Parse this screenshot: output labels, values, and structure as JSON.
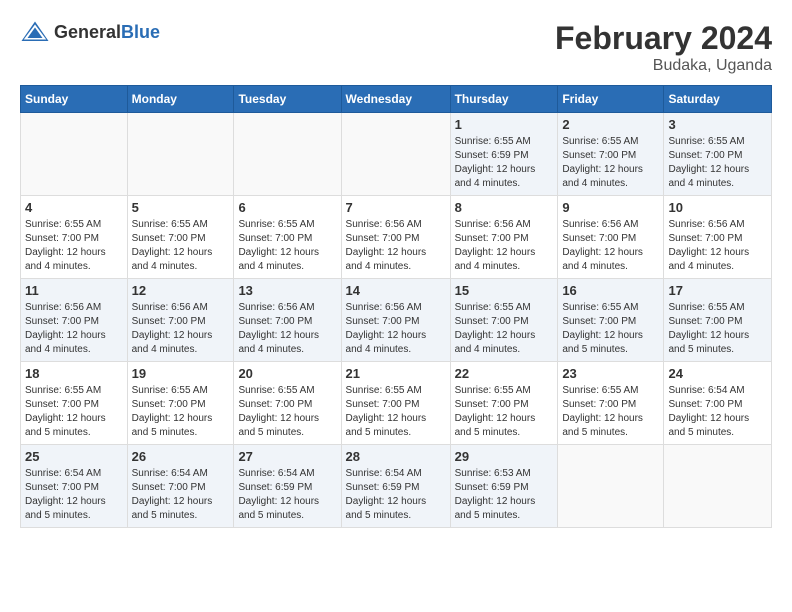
{
  "header": {
    "logo_general": "General",
    "logo_blue": "Blue",
    "title": "February 2024",
    "subtitle": "Budaka, Uganda"
  },
  "calendar": {
    "days_of_week": [
      "Sunday",
      "Monday",
      "Tuesday",
      "Wednesday",
      "Thursday",
      "Friday",
      "Saturday"
    ],
    "weeks": [
      [
        {
          "day": "",
          "info": ""
        },
        {
          "day": "",
          "info": ""
        },
        {
          "day": "",
          "info": ""
        },
        {
          "day": "",
          "info": ""
        },
        {
          "day": "1",
          "info": "Sunrise: 6:55 AM\nSunset: 6:59 PM\nDaylight: 12 hours\nand 4 minutes."
        },
        {
          "day": "2",
          "info": "Sunrise: 6:55 AM\nSunset: 7:00 PM\nDaylight: 12 hours\nand 4 minutes."
        },
        {
          "day": "3",
          "info": "Sunrise: 6:55 AM\nSunset: 7:00 PM\nDaylight: 12 hours\nand 4 minutes."
        }
      ],
      [
        {
          "day": "4",
          "info": "Sunrise: 6:55 AM\nSunset: 7:00 PM\nDaylight: 12 hours\nand 4 minutes."
        },
        {
          "day": "5",
          "info": "Sunrise: 6:55 AM\nSunset: 7:00 PM\nDaylight: 12 hours\nand 4 minutes."
        },
        {
          "day": "6",
          "info": "Sunrise: 6:55 AM\nSunset: 7:00 PM\nDaylight: 12 hours\nand 4 minutes."
        },
        {
          "day": "7",
          "info": "Sunrise: 6:56 AM\nSunset: 7:00 PM\nDaylight: 12 hours\nand 4 minutes."
        },
        {
          "day": "8",
          "info": "Sunrise: 6:56 AM\nSunset: 7:00 PM\nDaylight: 12 hours\nand 4 minutes."
        },
        {
          "day": "9",
          "info": "Sunrise: 6:56 AM\nSunset: 7:00 PM\nDaylight: 12 hours\nand 4 minutes."
        },
        {
          "day": "10",
          "info": "Sunrise: 6:56 AM\nSunset: 7:00 PM\nDaylight: 12 hours\nand 4 minutes."
        }
      ],
      [
        {
          "day": "11",
          "info": "Sunrise: 6:56 AM\nSunset: 7:00 PM\nDaylight: 12 hours\nand 4 minutes."
        },
        {
          "day": "12",
          "info": "Sunrise: 6:56 AM\nSunset: 7:00 PM\nDaylight: 12 hours\nand 4 minutes."
        },
        {
          "day": "13",
          "info": "Sunrise: 6:56 AM\nSunset: 7:00 PM\nDaylight: 12 hours\nand 4 minutes."
        },
        {
          "day": "14",
          "info": "Sunrise: 6:56 AM\nSunset: 7:00 PM\nDaylight: 12 hours\nand 4 minutes."
        },
        {
          "day": "15",
          "info": "Sunrise: 6:55 AM\nSunset: 7:00 PM\nDaylight: 12 hours\nand 4 minutes."
        },
        {
          "day": "16",
          "info": "Sunrise: 6:55 AM\nSunset: 7:00 PM\nDaylight: 12 hours\nand 5 minutes."
        },
        {
          "day": "17",
          "info": "Sunrise: 6:55 AM\nSunset: 7:00 PM\nDaylight: 12 hours\nand 5 minutes."
        }
      ],
      [
        {
          "day": "18",
          "info": "Sunrise: 6:55 AM\nSunset: 7:00 PM\nDaylight: 12 hours\nand 5 minutes."
        },
        {
          "day": "19",
          "info": "Sunrise: 6:55 AM\nSunset: 7:00 PM\nDaylight: 12 hours\nand 5 minutes."
        },
        {
          "day": "20",
          "info": "Sunrise: 6:55 AM\nSunset: 7:00 PM\nDaylight: 12 hours\nand 5 minutes."
        },
        {
          "day": "21",
          "info": "Sunrise: 6:55 AM\nSunset: 7:00 PM\nDaylight: 12 hours\nand 5 minutes."
        },
        {
          "day": "22",
          "info": "Sunrise: 6:55 AM\nSunset: 7:00 PM\nDaylight: 12 hours\nand 5 minutes."
        },
        {
          "day": "23",
          "info": "Sunrise: 6:55 AM\nSunset: 7:00 PM\nDaylight: 12 hours\nand 5 minutes."
        },
        {
          "day": "24",
          "info": "Sunrise: 6:54 AM\nSunset: 7:00 PM\nDaylight: 12 hours\nand 5 minutes."
        }
      ],
      [
        {
          "day": "25",
          "info": "Sunrise: 6:54 AM\nSunset: 7:00 PM\nDaylight: 12 hours\nand 5 minutes."
        },
        {
          "day": "26",
          "info": "Sunrise: 6:54 AM\nSunset: 7:00 PM\nDaylight: 12 hours\nand 5 minutes."
        },
        {
          "day": "27",
          "info": "Sunrise: 6:54 AM\nSunset: 6:59 PM\nDaylight: 12 hours\nand 5 minutes."
        },
        {
          "day": "28",
          "info": "Sunrise: 6:54 AM\nSunset: 6:59 PM\nDaylight: 12 hours\nand 5 minutes."
        },
        {
          "day": "29",
          "info": "Sunrise: 6:53 AM\nSunset: 6:59 PM\nDaylight: 12 hours\nand 5 minutes."
        },
        {
          "day": "",
          "info": ""
        },
        {
          "day": "",
          "info": ""
        }
      ]
    ]
  }
}
